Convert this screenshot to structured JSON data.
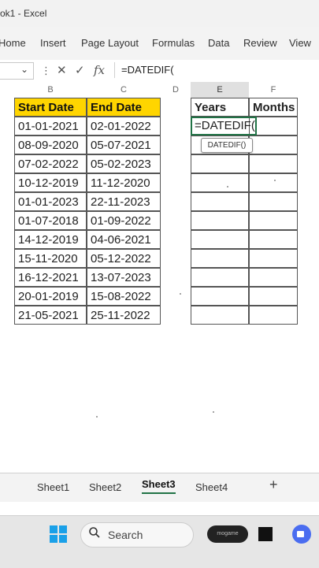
{
  "window": {
    "title": "ok1  -  Excel"
  },
  "ribbon": {
    "tabs": [
      {
        "label": "Home"
      },
      {
        "label": "Insert"
      },
      {
        "label": "Page Layout"
      },
      {
        "label": "Formulas"
      },
      {
        "label": "Data"
      },
      {
        "label": "Review"
      },
      {
        "label": "View"
      }
    ]
  },
  "formula_bar": {
    "cancel_icon": "✕",
    "enter_icon": "✓",
    "fx_label": "fx",
    "formula": "=DATEDIF("
  },
  "columns": [
    "B",
    "C",
    "D",
    "E",
    "F"
  ],
  "table": {
    "headers": [
      "Start Date",
      "End Date"
    ],
    "rows": [
      [
        "01-01-2021",
        "02-01-2022"
      ],
      [
        "08-09-2020",
        "05-07-2021"
      ],
      [
        "07-02-2022",
        "05-02-2023"
      ],
      [
        "10-12-2019",
        "11-12-2020"
      ],
      [
        "01-01-2023",
        "22-11-2023"
      ],
      [
        "01-07-2018",
        "01-09-2022"
      ],
      [
        "14-12-2019",
        "04-06-2021"
      ],
      [
        "15-11-2020",
        "05-12-2022"
      ],
      [
        "16-12-2021",
        "13-07-2023"
      ],
      [
        "20-01-2019",
        "15-08-2022"
      ],
      [
        "21-05-2021",
        "25-11-2022"
      ]
    ]
  },
  "result_table": {
    "headers": [
      "Years",
      "Months"
    ],
    "active_cell_value": "=DATEDIF(",
    "tooltip": "DATEDIF()"
  },
  "sheets": [
    {
      "label": "Sheet1"
    },
    {
      "label": "Sheet2"
    },
    {
      "label": "Sheet3",
      "active": true
    },
    {
      "label": "Sheet4"
    }
  ],
  "sheet_add_icon": "+",
  "taskbar": {
    "search_label": "Search",
    "badge_text": "mogame"
  },
  "colors": {
    "header_fill": "#ffd500",
    "accent": "#217346",
    "windows_blue": "#1aa0e8"
  }
}
